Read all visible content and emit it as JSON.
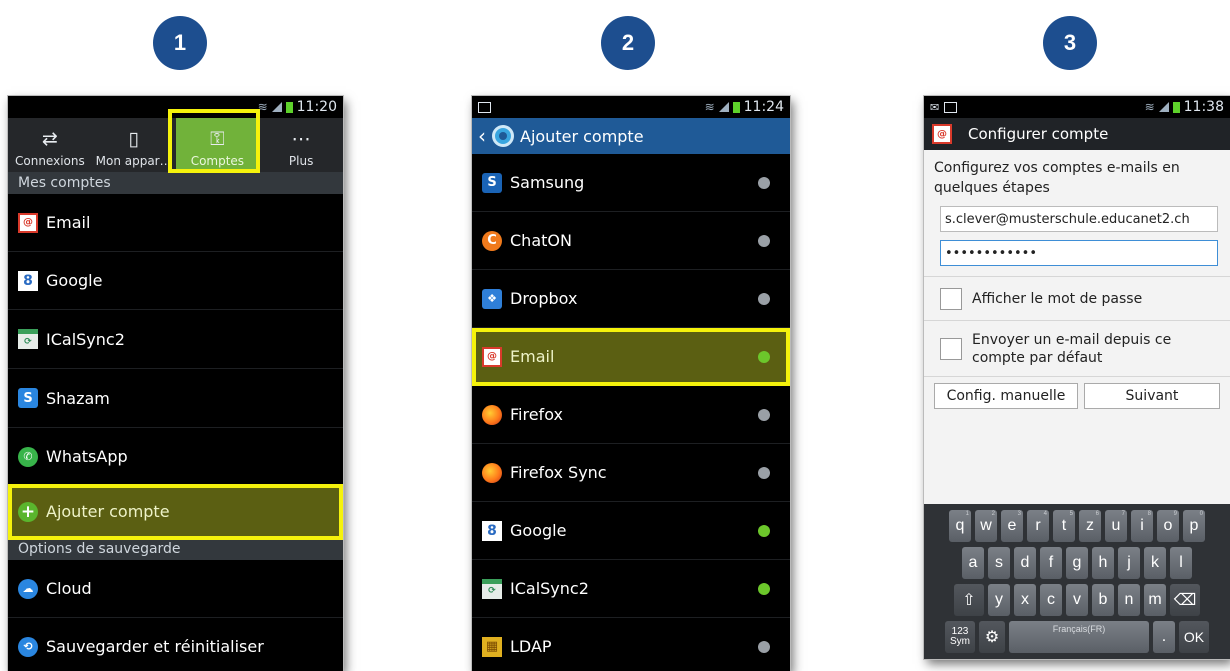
{
  "steps": [
    "1",
    "2",
    "3"
  ],
  "phone1": {
    "time": "11:20",
    "tabs": [
      {
        "label": "Connexions",
        "icon": "connections-icon"
      },
      {
        "label": "Mon appar…",
        "icon": "device-icon"
      },
      {
        "label": "Comptes",
        "icon": "key-icon"
      },
      {
        "label": "Plus",
        "icon": "more-icon"
      }
    ],
    "section1": "Mes comptes",
    "accounts": [
      "Email",
      "Google",
      "ICalSync2",
      "Shazam",
      "WhatsApp"
    ],
    "add_account": "Ajouter compte",
    "section2": "Options de sauvegarde",
    "backup": [
      "Cloud",
      "Sauvegarder et réinitialiser"
    ]
  },
  "phone2": {
    "time": "11:24",
    "title": "Ajouter compte",
    "items": [
      {
        "label": "Samsung",
        "enabled": false
      },
      {
        "label": "ChatON",
        "enabled": false
      },
      {
        "label": "Dropbox",
        "enabled": false
      },
      {
        "label": "Email",
        "enabled": true
      },
      {
        "label": "Firefox",
        "enabled": false
      },
      {
        "label": "Firefox Sync",
        "enabled": false
      },
      {
        "label": "Google",
        "enabled": true
      },
      {
        "label": "ICalSync2",
        "enabled": true
      },
      {
        "label": "LDAP",
        "enabled": false
      }
    ]
  },
  "phone3": {
    "time": "11:38",
    "title": "Configurer compte",
    "intro": "Configurez vos comptes e-mails en quelques étapes",
    "email_value": "s.clever@musterschule.educanet2.ch",
    "password_value": "••••••••••••",
    "show_password": "Afficher le mot de passe",
    "send_default": "Envoyer un e-mail depuis ce compte par défaut",
    "manual_button": "Config. manuelle",
    "next_button": "Suivant",
    "keyboard": {
      "row1": [
        "q",
        "w",
        "e",
        "r",
        "t",
        "z",
        "u",
        "i",
        "o",
        "p"
      ],
      "row1_hints": [
        "1",
        "2",
        "3",
        "4",
        "5",
        "6",
        "7",
        "8",
        "9",
        "0"
      ],
      "row2": [
        "a",
        "s",
        "d",
        "f",
        "g",
        "h",
        "j",
        "k",
        "l"
      ],
      "row3": [
        "y",
        "x",
        "c",
        "v",
        "b",
        "n",
        "m"
      ],
      "sym_label": "123 Sym",
      "space_label": "Français(FR)",
      "dot_label": ".",
      "ok_label": "OK"
    }
  },
  "colors": {
    "highlight": "#f5f20c",
    "step_circle": "#1d4e8f",
    "android_blue": "#1f5a97",
    "toggle_on": "#6cc72b"
  }
}
